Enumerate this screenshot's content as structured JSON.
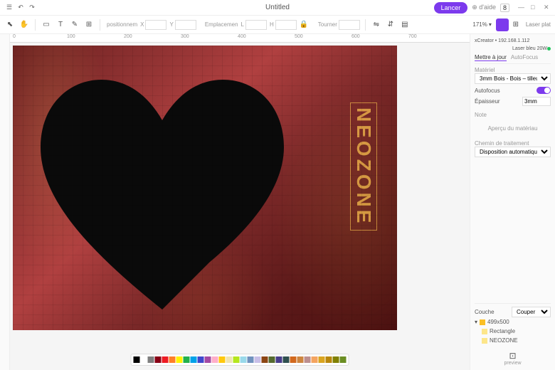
{
  "titlebar": {
    "title": "Untitled",
    "launch": "Lancer",
    "help": "⊕ d'aide",
    "badge": "8"
  },
  "toolbar": {
    "pos_label": "positionnem",
    "spacing_label": "Emplacemen",
    "rotate_label": "Tourner",
    "zoom": "171%",
    "laser": "Laser plat"
  },
  "ruler": {
    "t0": "0",
    "t1": "100",
    "t2": "200",
    "t3": "300",
    "t4": "400",
    "t5": "500",
    "t6": "600",
    "t7": "700"
  },
  "artwork": {
    "text": "NEOZONE"
  },
  "panel": {
    "device": "xCreator • 192.168.1.112",
    "status": "Laser bleu 20W",
    "tab1": "Mettre à jour",
    "tab2": "AutoFocus",
    "material_label": "Matériel",
    "material": "3mm Bois - Bois – tilleul",
    "autofocus": "Autofocus",
    "thickness_label": "Épaisseur",
    "thickness": "3mm",
    "note": "Note",
    "preview": "Aperçu du matériau",
    "path_label": "Chemin de traitement",
    "path": "Disposition automatique",
    "layer_label": "Couche",
    "layer_mode": "Couper",
    "layer1": "499x500",
    "layer2": "Rectangle",
    "layer3": "NEOZONE",
    "preview_btn": "preview"
  },
  "palette": [
    "#000",
    "#fff",
    "#7f7f7f",
    "#880015",
    "#ed1c24",
    "#ff7f27",
    "#fff200",
    "#22b14c",
    "#00a2e8",
    "#3f48cc",
    "#a349a4",
    "#ffaec9",
    "#ffc90e",
    "#efe4b0",
    "#b5e61d",
    "#99d9ea",
    "#7092be",
    "#c8bfe7",
    "#8b4513",
    "#556b2f",
    "#483d8b",
    "#2f4f4f",
    "#d2691e",
    "#cd853f",
    "#bc8f8f",
    "#f4a460",
    "#daa520",
    "#b8860b",
    "#808000",
    "#6b8e23"
  ]
}
